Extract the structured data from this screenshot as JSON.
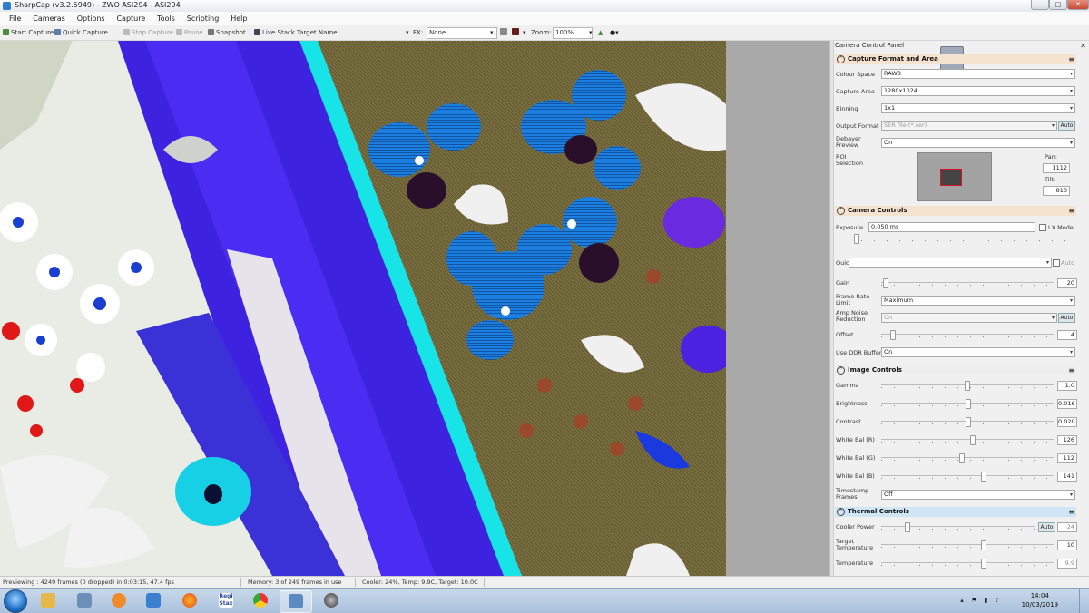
{
  "window": {
    "title": "SharpCap (v3.2.5949) - ZWO ASI294 - ASI294",
    "min_label": "–",
    "max_label": "□",
    "close_label": "✕"
  },
  "menu": [
    "File",
    "Cameras",
    "Options",
    "Capture",
    "Tools",
    "Scripting",
    "Help"
  ],
  "toolbar": {
    "start_capture": "Start Capture",
    "quick_capture": "Quick Capture",
    "stop_capture": "Stop Capture",
    "pause": "Pause",
    "snapshot": "Snapshot",
    "live_stack": "Live Stack",
    "target_name_label": "Target Name:",
    "fx_label": "FX:",
    "fx_value": "None",
    "zoom_label": "Zoom:",
    "zoom_value": "100%"
  },
  "panel": {
    "title": "Camera Control Panel",
    "close_label": "✕",
    "sections": {
      "capture": "Capture Format and Area",
      "camera": "Camera Controls",
      "image": "Image Controls",
      "thermal": "Thermal Controls"
    },
    "capture": {
      "colour_space_label": "Colour Space",
      "colour_space_value": "RAW8",
      "capture_area_label": "Capture Area",
      "capture_area_value": "1280x1024",
      "binning_label": "Binning",
      "binning_value": "1x1",
      "output_format_label": "Output Format",
      "output_format_value": "SER file (*.ser)",
      "output_auto": "Auto",
      "debayer_label": "Debayer Preview",
      "debayer_value": "On",
      "roi_label": "ROI Selection",
      "pan_label": "Pan:",
      "pan_value": "1112",
      "tilt_label": "Tilt:",
      "tilt_value": "810"
    },
    "camera": {
      "exposure_label": "Exposure",
      "exposure_value": "0.050 ms",
      "lx_mode_label": "LX Mode",
      "quick_pick_label": "Quick Pick",
      "quick_pick_auto": "Auto",
      "gain_label": "Gain",
      "gain_value": "20",
      "frame_rate_limit_label": "Frame Rate Limit",
      "frame_rate_limit_value": "Maximum",
      "amp_noise_label": "Amp Noise Reduction",
      "amp_noise_value": "On",
      "amp_noise_auto": "Auto",
      "offset_label": "Offset",
      "offset_value": "4",
      "usb_label": "Use DDR Buffer",
      "usb_value": "On"
    },
    "image": {
      "gamma_label": "Gamma",
      "gamma_value": "1.0",
      "brightness_label": "Brightness",
      "brightness_value": "0.016",
      "contrast_label": "Contrast",
      "contrast_value": "0.020",
      "wb_r_label": "White Bal (R)",
      "wb_r_value": "126",
      "wb_g_label": "White Bal (G)",
      "wb_g_value": "112",
      "wb_b_label": "White Bal (B)",
      "wb_b_value": "141",
      "timestamp_label": "Timestamp Frames",
      "timestamp_value": "Off"
    },
    "thermal": {
      "cooler_power_label": "Cooler Power",
      "cooler_auto": "Auto",
      "cooler_value": "24",
      "target_temp_label": "Target Temperature",
      "target_temp_value": "10",
      "temperature_label": "Temperature",
      "temperature_value": "9.9"
    }
  },
  "status": {
    "preview": "Previewing : 4249 frames (0 dropped) in 0:03:15, 47.4 fps",
    "memory": "Memory: 3 of 249 frames in use",
    "cooler": "Cooler: 24%, Temp: 9.9C, Target: 10.0C"
  },
  "taskbar": {
    "clock_time": "14:04",
    "clock_date": "10/03/2019",
    "tray": "▴ ⚑ ▮ ♪"
  },
  "colors": {
    "accent_section_capture": "#f6e3cf",
    "accent_section_thermal": "#cfe6f6"
  }
}
